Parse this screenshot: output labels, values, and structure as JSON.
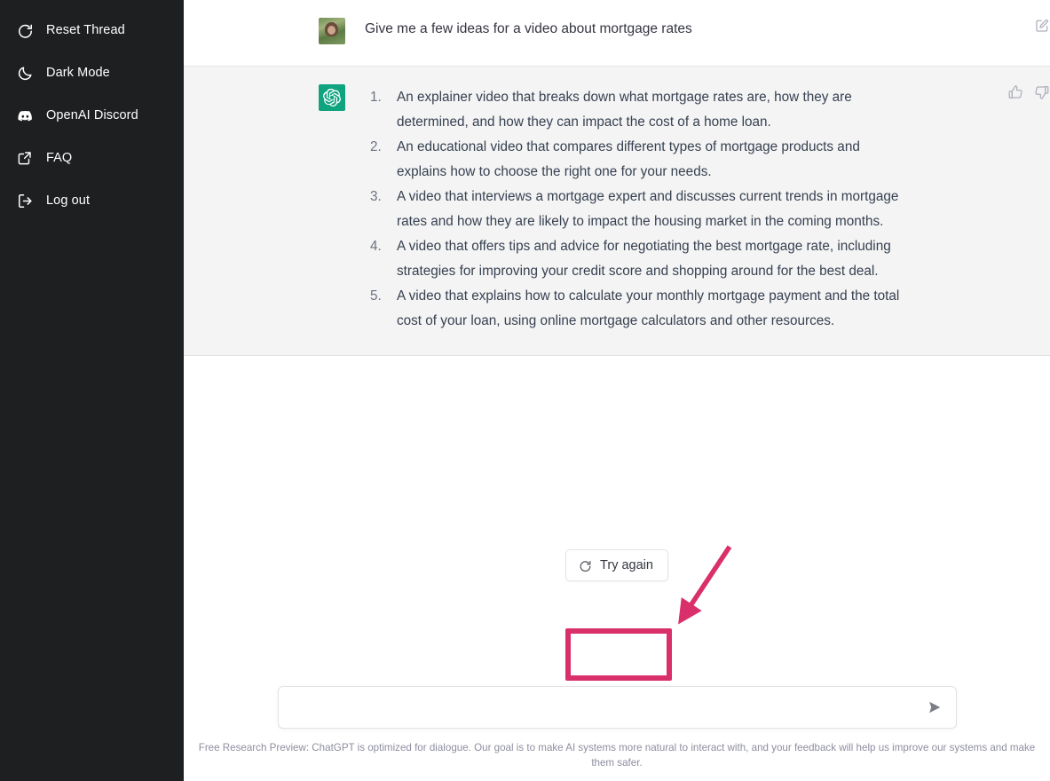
{
  "sidebar": {
    "items": [
      {
        "label": "Reset Thread",
        "icon": "reset-thread-icon"
      },
      {
        "label": "Dark Mode",
        "icon": "moon-icon"
      },
      {
        "label": "OpenAI Discord",
        "icon": "discord-icon"
      },
      {
        "label": "FAQ",
        "icon": "external-link-icon"
      },
      {
        "label": "Log out",
        "icon": "logout-icon"
      }
    ]
  },
  "conversation": {
    "user_message": {
      "text": "Give me a few ideas for a video about mortgage rates",
      "avatar": "user-photo-avatar",
      "edit_icon": "edit-icon"
    },
    "assistant_message": {
      "avatar": "openai-logo-icon",
      "items": [
        "An explainer video that breaks down what mortgage rates are, how they are determined, and how they can impact the cost of a home loan.",
        "An educational video that compares different types of mortgage products and explains how to choose the right one for your needs.",
        "A video that interviews a mortgage expert and discusses current trends in mortgage rates and how they are likely to impact the housing market in the coming months.",
        "A video that offers tips and advice for negotiating the best mortgage rate, including strategies for improving your credit score and shopping around for the best deal.",
        "A video that explains how to calculate your monthly mortgage payment and the total cost of your loan, using online mortgage calculators and other resources."
      ],
      "thumbs_up_icon": "thumbs-up-icon",
      "thumbs_down_icon": "thumbs-down-icon"
    }
  },
  "retry": {
    "label": "Try again",
    "icon": "refresh-icon"
  },
  "composer": {
    "value": "",
    "placeholder": "",
    "send_icon": "send-icon"
  },
  "footer": {
    "note": "Free Research Preview: ChatGPT is optimized for dialogue. Our goal is to make AI systems more natural to interact with, and your feedback will help us improve our systems and make them safer."
  },
  "annotation": {
    "highlight_color": "#d9306b",
    "arrow_color": "#d9306b",
    "target": "try-again-button"
  },
  "colors": {
    "sidebar_bg": "#1e1f20",
    "assistant_bg": "#f4f4f4",
    "brand_green": "#10a37f",
    "accent_pink": "#d9306b"
  }
}
